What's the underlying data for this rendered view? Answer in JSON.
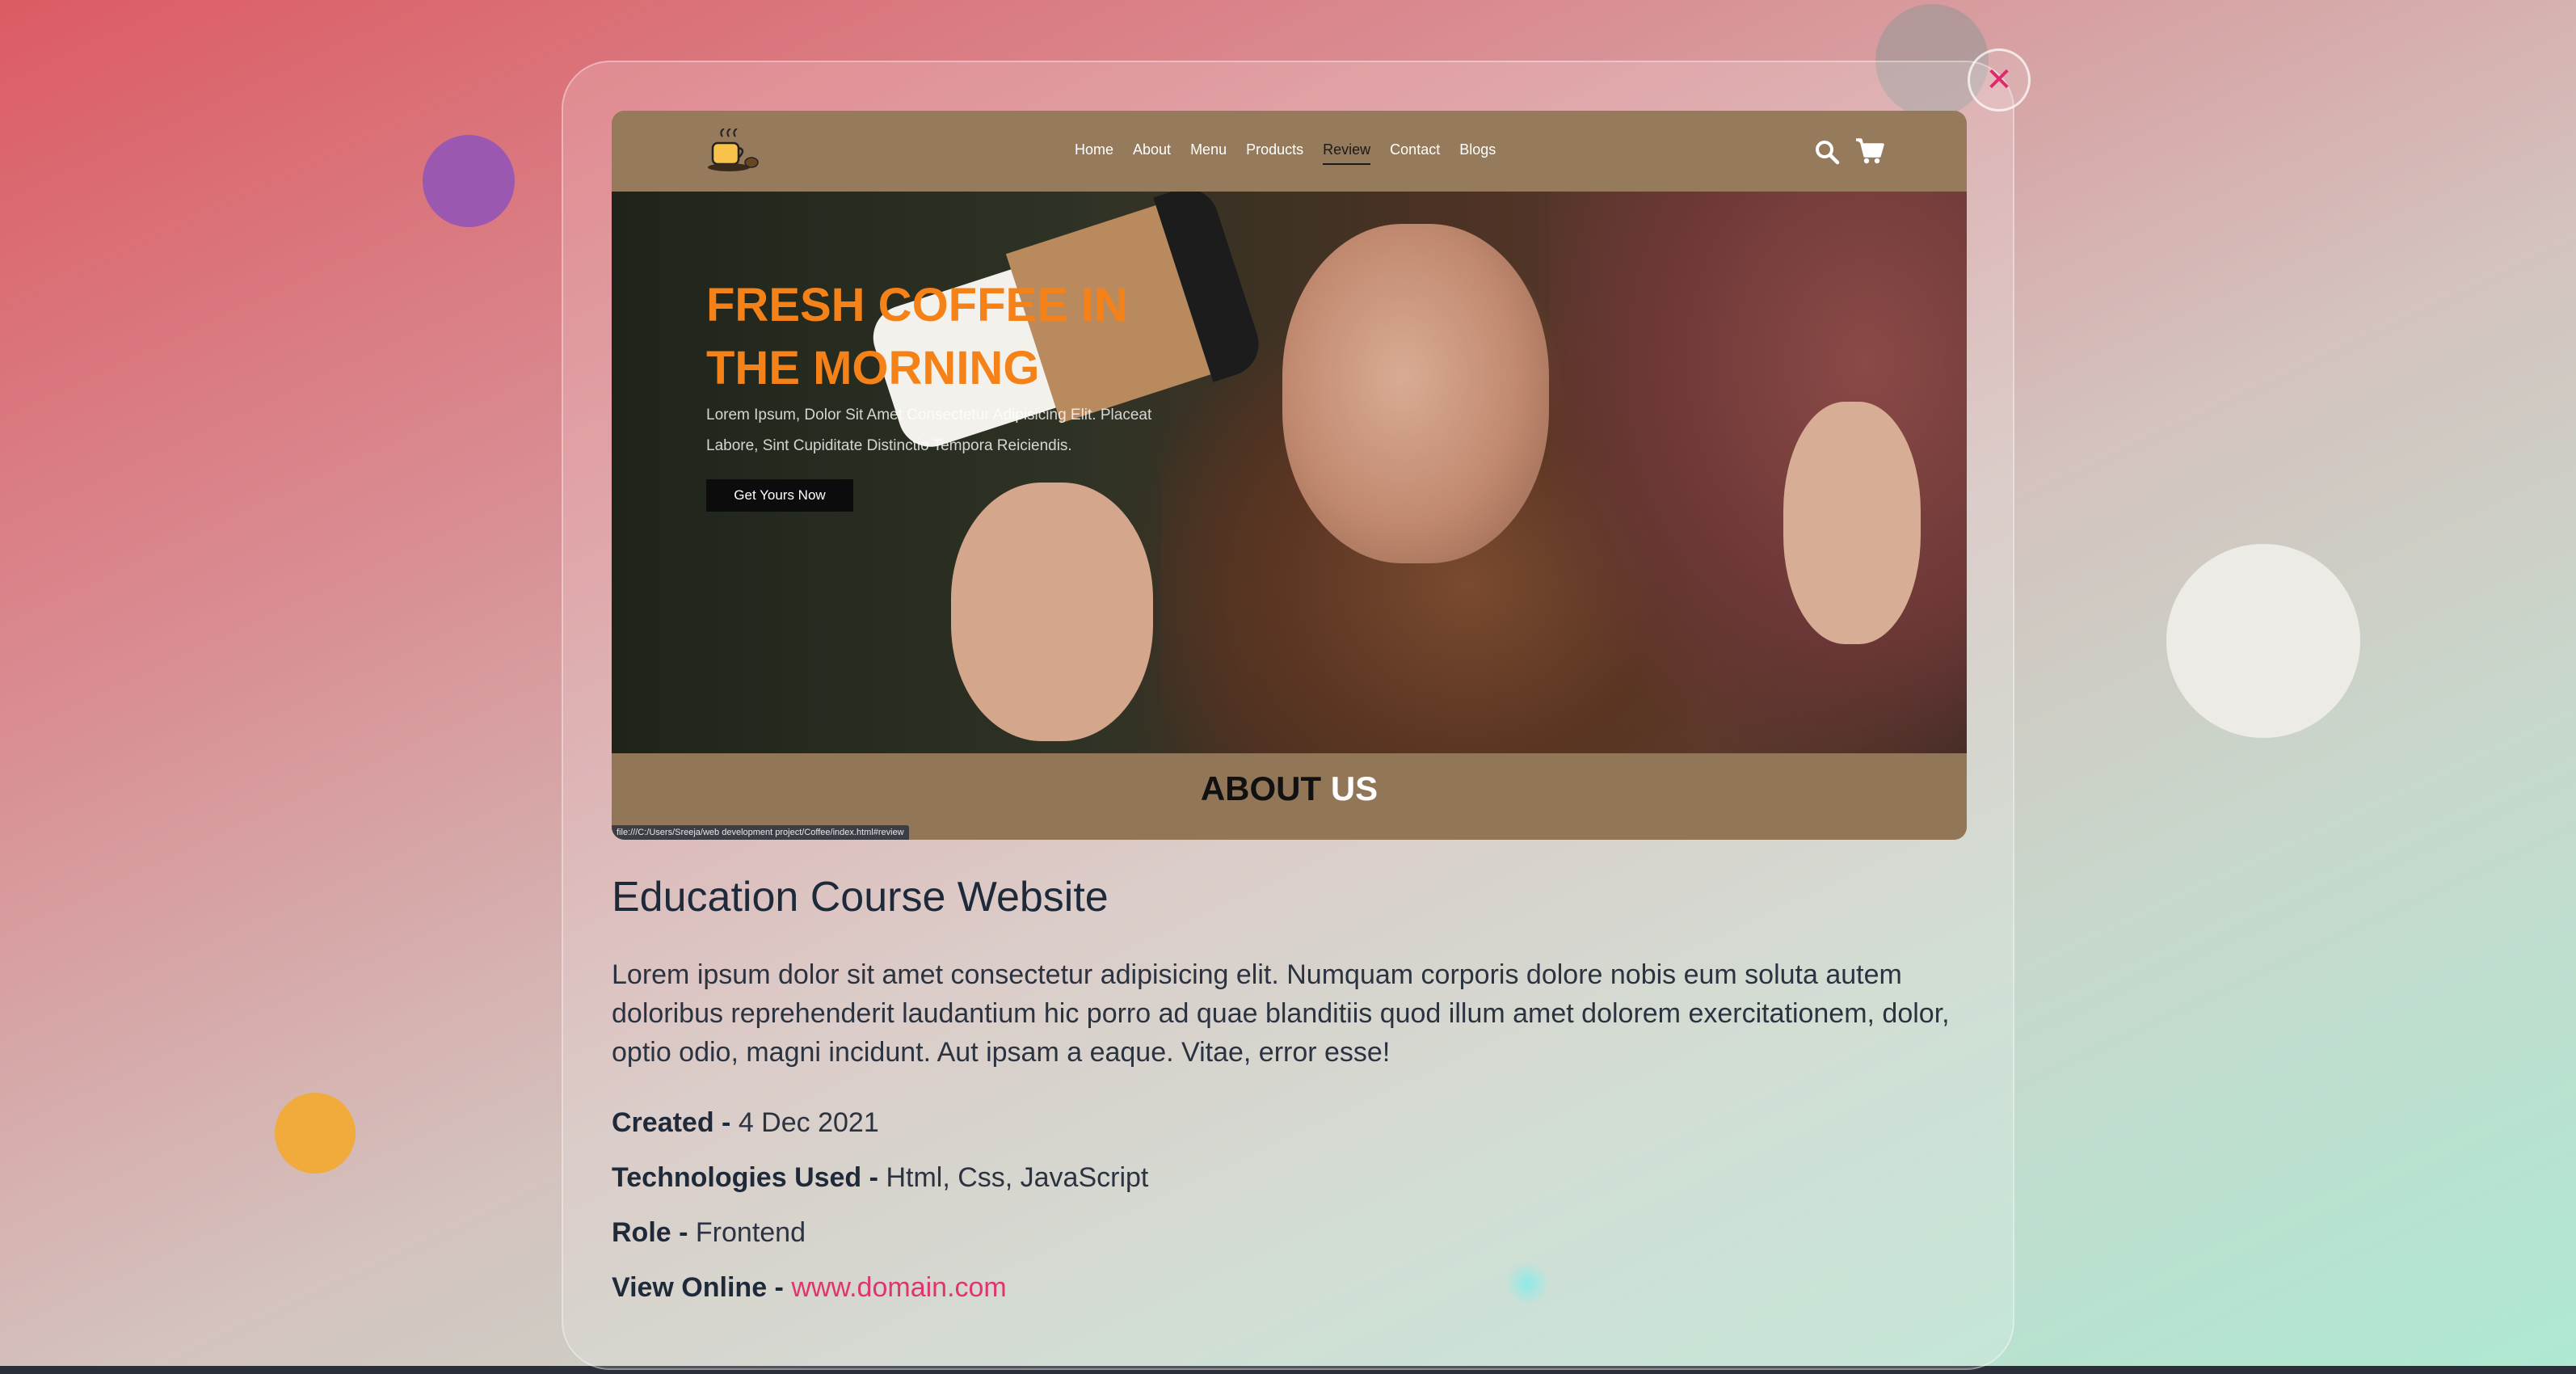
{
  "preview": {
    "nav": {
      "links": [
        "Home",
        "About",
        "Menu",
        "Products",
        "Review",
        "Contact",
        "Blogs"
      ],
      "active": "Review"
    },
    "hero": {
      "title_line1": "FRESH COFFEE IN",
      "title_line2": "THE MORNING",
      "subtitle_line1": "Lorem Ipsum, Dolor Sit Amet Consectetur Adipisicing Elit. Placeat",
      "subtitle_line2": "Labore, Sint Cupiditate Distinctio Tempora Reiciendis.",
      "button": "Get Yours Now"
    },
    "about": {
      "dark": "ABOUT",
      "light": "US"
    },
    "status_url": "file:///C:/Users/Sreeja/web development project/Coffee/index.html#review"
  },
  "project": {
    "title": "Education Course Website",
    "description": "Lorem ipsum dolor sit amet consectetur adipisicing elit. Numquam corporis dolore nobis eum soluta autem doloribus reprehenderit laudantium hic porro ad quae blanditiis quod illum amet dolorem exercitationem, dolor, optio odio, magni incidunt. Aut ipsam a eaque. Vitae, error esse!",
    "created_label": "Created -",
    "created_value": "4 Dec 2021",
    "tech_label": "Technologies Used -",
    "tech_value": "Html, Css, JavaScript",
    "role_label": "Role -",
    "role_value": "Frontend",
    "online_label": "View Online -",
    "online_value": "www.domain.com"
  },
  "close_icon": "✕",
  "colors": {
    "accent": "#e0346e",
    "hero_title": "#f58219",
    "nav_bg": "#957a5b"
  }
}
